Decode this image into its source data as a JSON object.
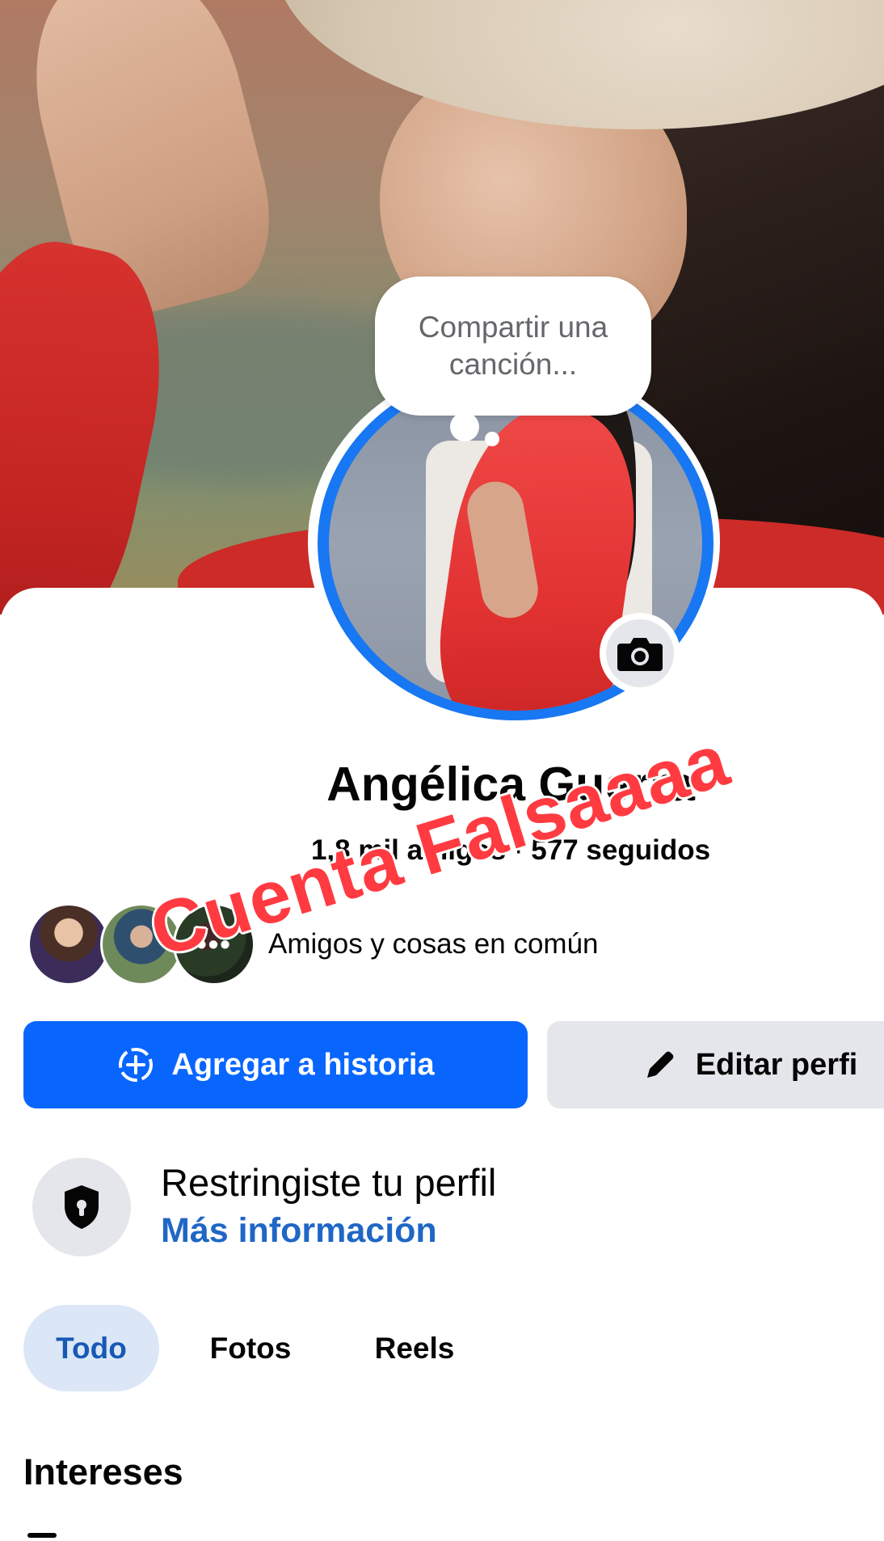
{
  "bubble": {
    "text": "Compartir una canción..."
  },
  "profile": {
    "name": "Angélica Guerra",
    "friends": "1,8 mil amigos",
    "separator": "·",
    "following": "577 seguidos",
    "mutual_text": "Amigos y cosas en común",
    "mutual_more": "•••"
  },
  "watermark": {
    "text": "Cuenta Falsaaaa"
  },
  "actions": {
    "add_story": "Agregar a historia",
    "edit_profile": "Editar perfi"
  },
  "restriction": {
    "title": "Restringiste tu perfil",
    "link": "Más información"
  },
  "tabs": [
    {
      "label": "Todo",
      "active": true
    },
    {
      "label": "Fotos",
      "active": false
    },
    {
      "label": "Reels",
      "active": false
    }
  ],
  "section": {
    "title": "Intereses"
  },
  "icons": {
    "camera": "camera-icon",
    "add_story": "add-circle-icon",
    "edit": "pencil-icon",
    "restrict": "shield-lock-icon"
  },
  "colors": {
    "primary": "#0866ff",
    "link": "#1f67c6",
    "watermark": "#ff3b41",
    "tab_active_bg": "#dbe7f6",
    "avatar_ring": "#1877f2"
  }
}
